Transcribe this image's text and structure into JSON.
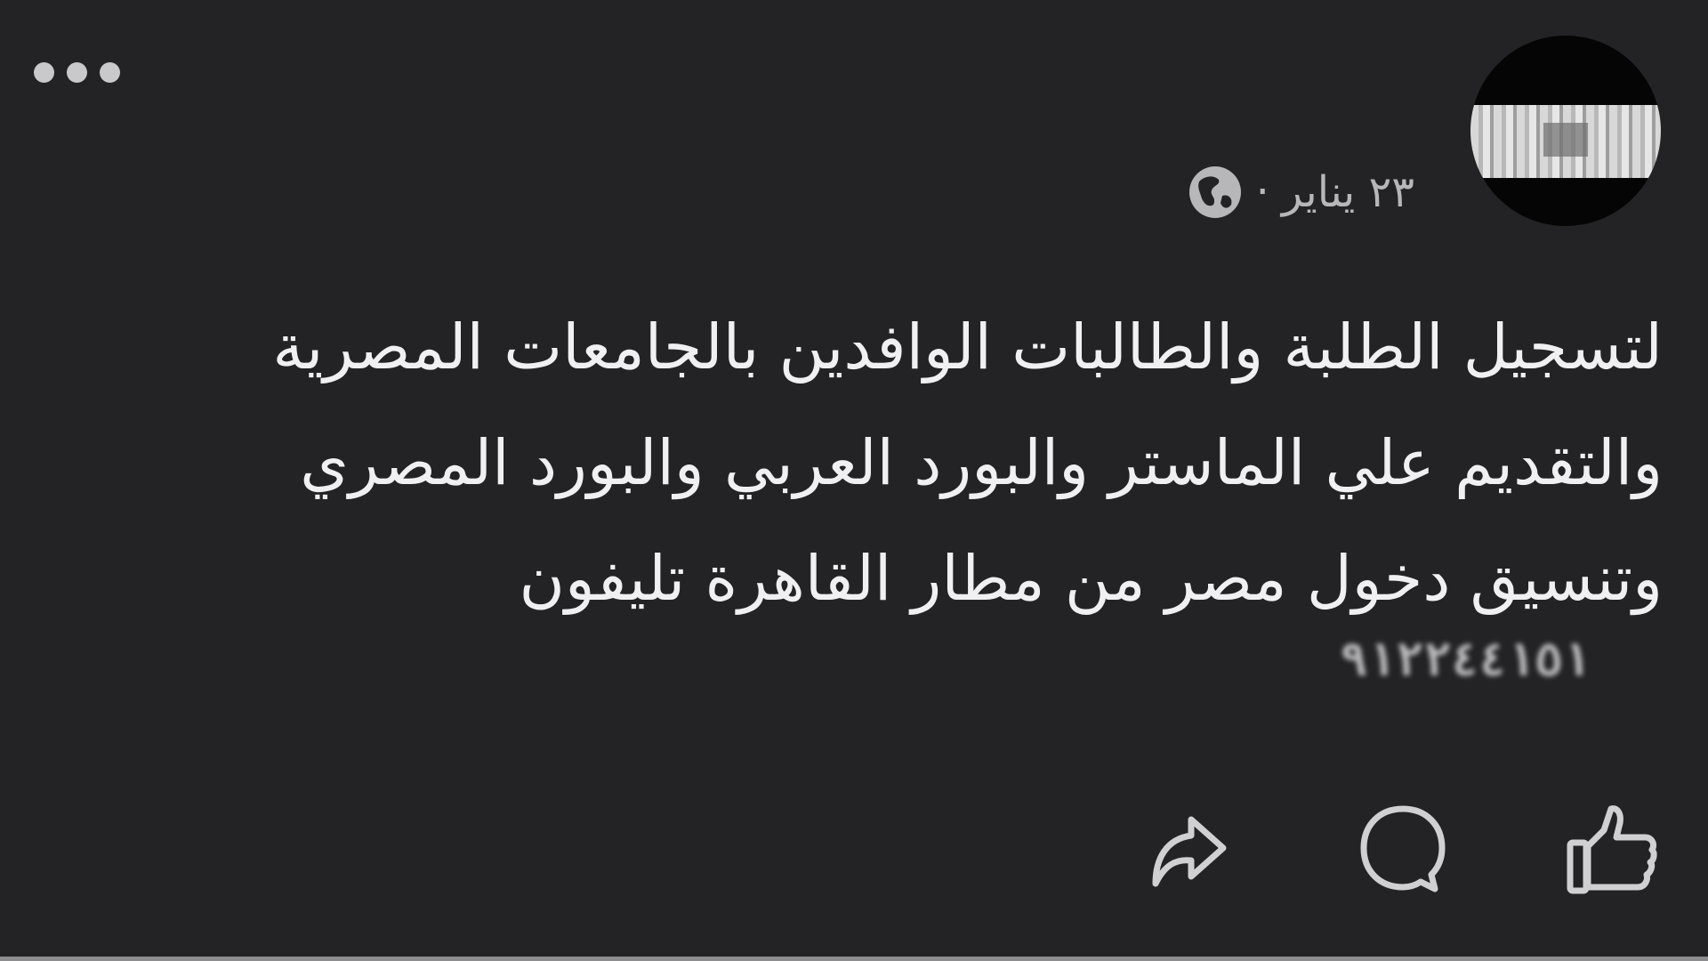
{
  "post": {
    "date": "٢٣ يناير",
    "separator": "·",
    "body_lines": [
      "لتسجيل الطلبة والطالبات الوافدين بالجامعات المصرية",
      "والتقديم علي الماستر والبورد العربي والبورد المصري",
      "وتنسيق دخول مصر من مطار القاهرة تليفون"
    ],
    "phone": "٩١٢٢٤٤١٥١"
  },
  "icons": {
    "more": "more-dots-icon",
    "globe": "globe-icon",
    "like": "thumbs-up-icon",
    "comment": "comment-icon",
    "share": "share-icon"
  },
  "colors": {
    "background": "#232325",
    "text": "#f0f0f2",
    "muted": "#b7b7b9",
    "icon": "#d0d0d2"
  }
}
